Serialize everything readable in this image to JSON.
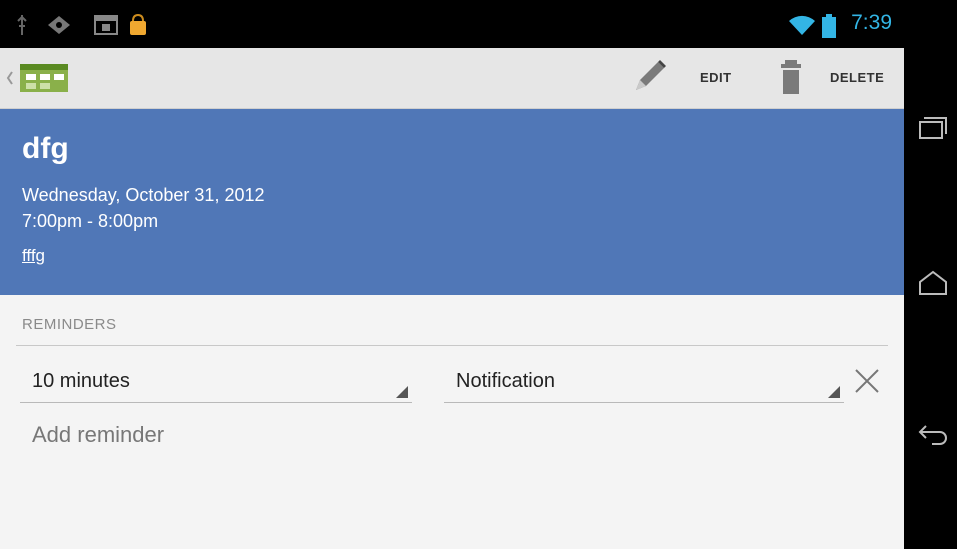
{
  "status_bar": {
    "time": "7:39"
  },
  "action_bar": {
    "edit_label": "EDIT",
    "delete_label": "DELETE"
  },
  "event": {
    "title": "dfg",
    "date": "Wednesday, October 31, 2012",
    "time": "7:00pm - 8:00pm",
    "location": "fffg"
  },
  "reminders": {
    "header": "REMINDERS",
    "items": [
      {
        "time": "10 minutes",
        "method": "Notification"
      }
    ],
    "add_label": "Add reminder"
  },
  "colors": {
    "header_bg": "#5077b7",
    "status_accent": "#33b5e5"
  }
}
